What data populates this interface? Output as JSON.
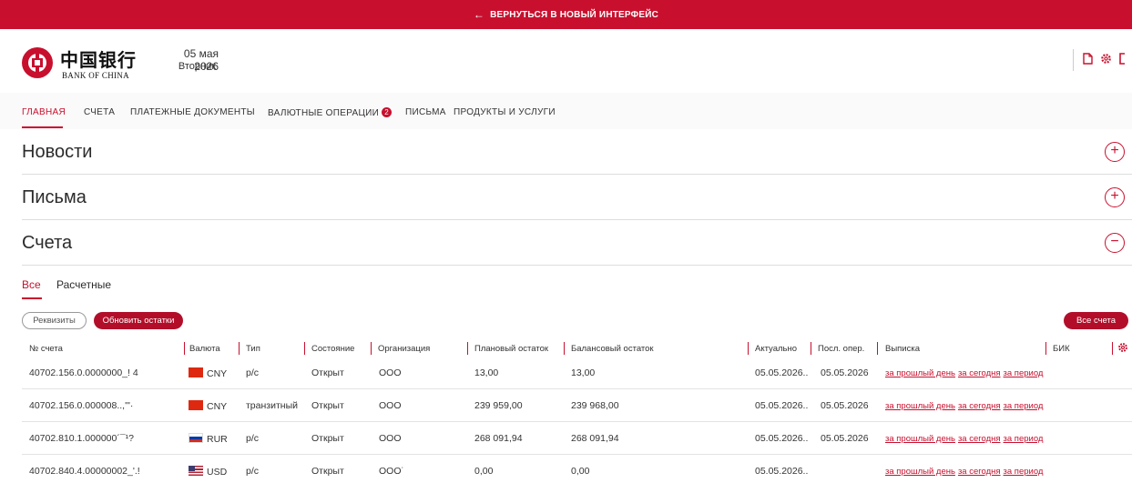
{
  "topbar": {
    "arrow": "←",
    "label": "ВЕРНУТЬСЯ В НОВЫЙ ИНТЕРФЕЙС"
  },
  "header": {
    "logo_cn": "中国银行",
    "logo_en": "BANK OF CHINA",
    "date": "05 мая 2026",
    "weekday": "Вторник",
    "icons": [
      "document-icon",
      "gear-icon",
      "exit-icon"
    ]
  },
  "nav": {
    "items": [
      "ГЛАВНАЯ",
      "СЧЕТА",
      "ПЛАТЕЖНЫЕ ДОКУМЕНТЫ",
      "ВАЛЮТНЫЕ ОПЕРАЦИИ",
      "ПИСЬМА",
      "ПРОДУКТЫ И УСЛУГИ"
    ],
    "badge": "2",
    "active": "ГЛАВНАЯ"
  },
  "sections": [
    {
      "title": "Новости",
      "state": "collapsed"
    },
    {
      "title": "Письма",
      "state": "collapsed"
    },
    {
      "title": "Счета",
      "state": "expanded"
    }
  ],
  "accounts": {
    "tabs": [
      "Все",
      "Расчетные"
    ],
    "buttons": {
      "details": "Реквизиты",
      "refresh": "Обновить остатки",
      "all": "Все счета"
    },
    "columns": [
      "№ счета",
      "Валюта",
      "Тип",
      "Состояние",
      "Организация",
      "Плановый остаток",
      "Балансовый остаток",
      "Актуально",
      "Посл. опер.",
      "Выписка",
      "БИК"
    ],
    "links": {
      "prev_day": "за прошлый день",
      "today": "за сегодня",
      "period": "за период"
    },
    "rows": [
      {
        "account": "40702.156.0.0000000_! 4",
        "currency": "CNY",
        "type": "р/с",
        "status": "Открыт",
        "org": "ООО",
        "planned": "13,00",
        "balance": "13,00",
        "actual": "05.05.2026..",
        "last_op": "05.05.2026"
      },
      {
        "account": "40702.156.0.000008..,'\"·",
        "currency": "CNY",
        "type": "транзитный",
        "status": "Открыт",
        "org": "ООО",
        "planned": "239 959,00",
        "balance": "239 968,00",
        "actual": "05.05.2026..",
        "last_op": "05.05.2026"
      },
      {
        "account": "40702.810.1.000000´¯¹?",
        "currency": "RUR",
        "type": "р/с",
        "status": "Открыт",
        "org": "ООО",
        "planned": "268 091,94",
        "balance": "268 091,94",
        "actual": "05.05.2026..",
        "last_op": "05.05.2026"
      },
      {
        "account": "40702.840.4.00000002_'.!",
        "currency": "USD",
        "type": "р/с",
        "status": "Открыт",
        "org": "ООО˙",
        "planned": "0,00",
        "balance": "0,00",
        "actual": "05.05.2026..",
        "last_op": ""
      }
    ]
  },
  "colors": {
    "brand": "#c8102e",
    "brand_dark": "#b20e2a"
  }
}
